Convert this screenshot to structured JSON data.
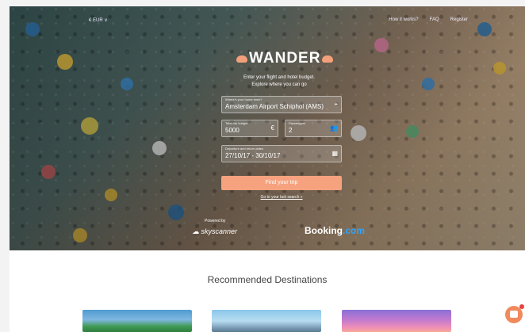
{
  "topbar": {
    "currency": "€ EUR ∨",
    "nav": [
      "How it works?",
      "FAQ",
      "Register"
    ]
  },
  "brand": {
    "name": "WANDER"
  },
  "tagline": {
    "line1": "Enter your flight and hotel budget.",
    "line2": "Explore where you can go"
  },
  "search": {
    "origin": {
      "label": "Where's your home town?",
      "value": "Amsterdam Airport Schiphol (AMS)",
      "icon": "map-pin-icon"
    },
    "budget": {
      "label": "Total trip budget",
      "value": "5000",
      "icon": "euro-icon"
    },
    "passengers": {
      "label": "Passengers",
      "value": "2",
      "icon": "people-icon"
    },
    "dates": {
      "label": "Departure and return dates",
      "value": "27/10/17 - 30/10/17",
      "icon": "calendar-icon"
    },
    "submit": "Find your trip",
    "last_search": "Go to your last search »"
  },
  "partners": {
    "powered_by": "Powered by",
    "skyscanner": "skyscanner",
    "booking_main": "Booking",
    "booking_dot": ".com"
  },
  "recommended": {
    "title": "Recommended Destinations"
  },
  "colors": {
    "accent": "#f6a27f",
    "booking_dot": "#2ea5ff"
  }
}
